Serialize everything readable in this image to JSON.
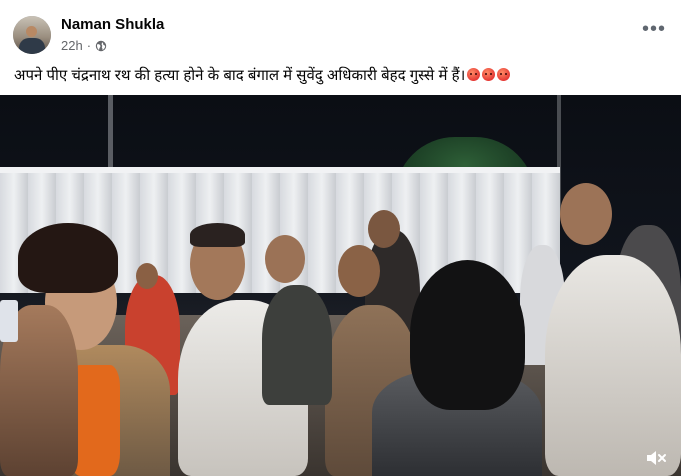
{
  "post": {
    "author": "Naman Shukla",
    "time": "22h",
    "separator": "·",
    "privacy_icon": "globe-icon",
    "more_icon": "more-horizontal-icon",
    "more_label": "•••",
    "caption": "अपने पीए चंद्रनाथ रथ की हत्या होने के बाद बंगाल में सुवेंदु अधिकारी बेहद गुस्से में हैं।",
    "caption_emojis": [
      "angry-face-emoji",
      "angry-face-emoji",
      "angry-face-emoji"
    ]
  },
  "video": {
    "description_icon": "video-thumbnail",
    "volume_icon": "volume-muted-icon"
  },
  "colors": {
    "text_primary": "#050505",
    "text_secondary": "#65676b",
    "background": "#ffffff"
  }
}
